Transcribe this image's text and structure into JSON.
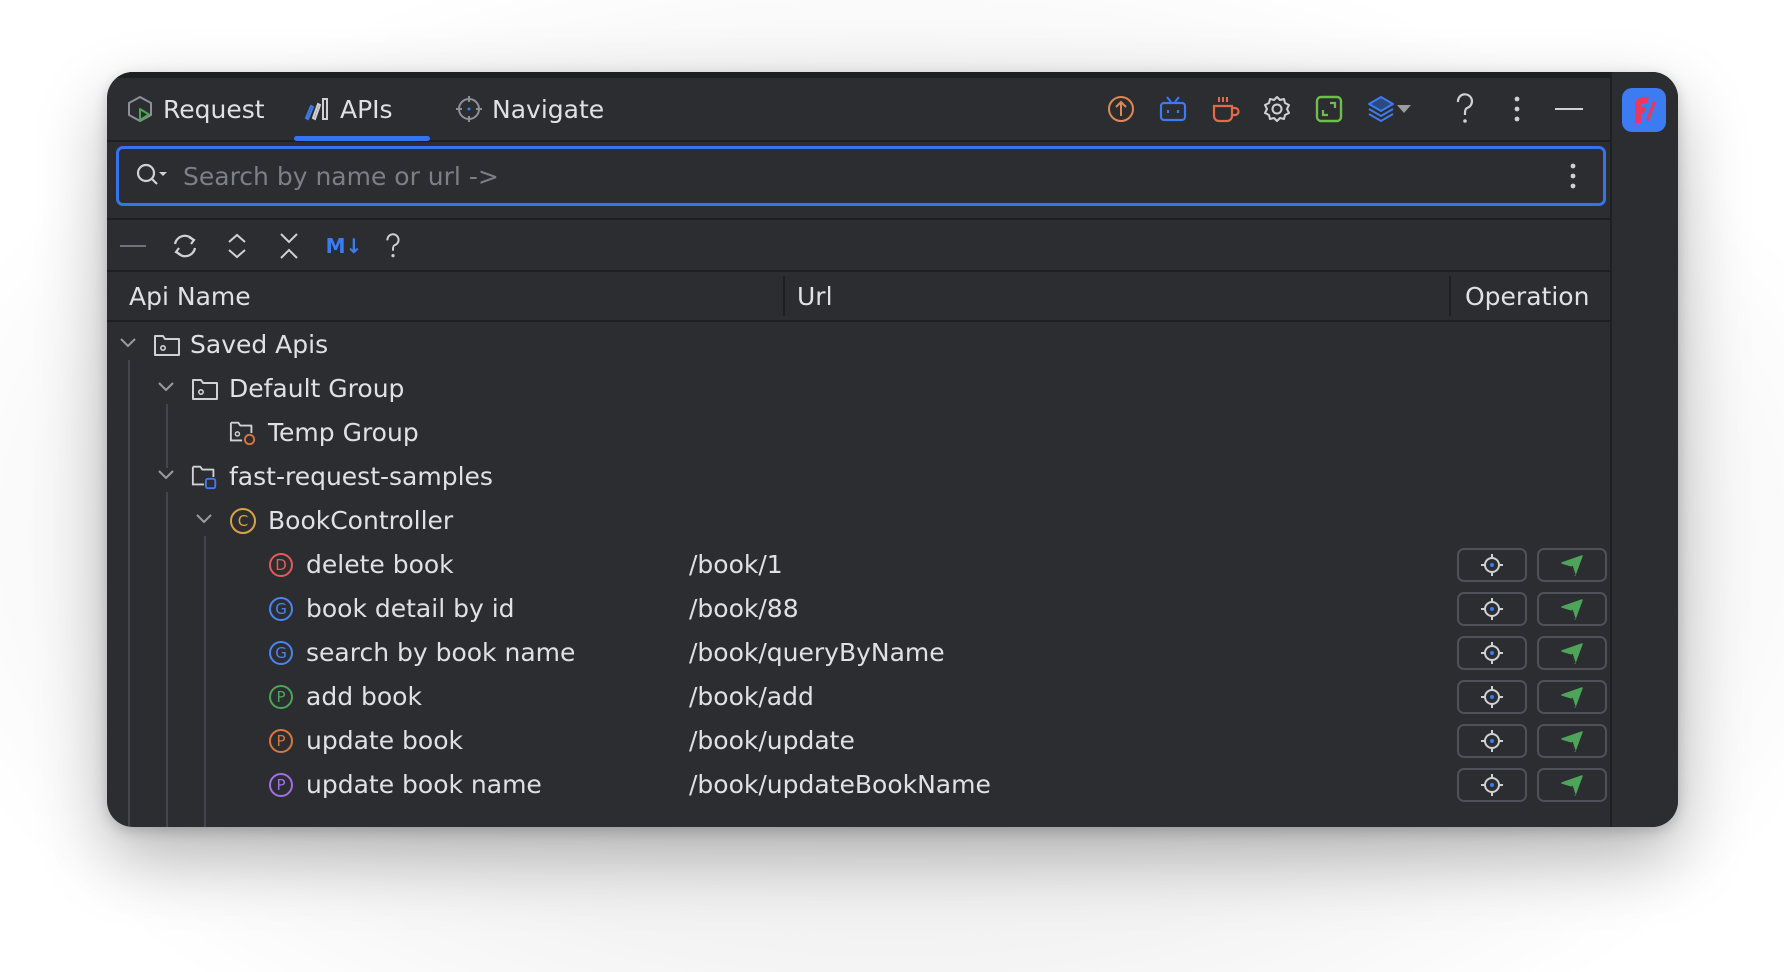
{
  "tabs": [
    {
      "label": "Request",
      "icon": "request-shield-play-icon",
      "active": false
    },
    {
      "label": "APIs",
      "icon": "apis-bars-icon",
      "active": true
    },
    {
      "label": "Navigate",
      "icon": "crosshair-icon",
      "active": false
    }
  ],
  "header_icons": [
    {
      "name": "upload-icon",
      "color": "#e08855"
    },
    {
      "name": "bilibili-tv-icon",
      "color": "#3d7bf2"
    },
    {
      "name": "coffee-cup-icon",
      "color": "#e8694a"
    },
    {
      "name": "gear-icon",
      "color": "#cfd1d5"
    },
    {
      "name": "expand-frame-icon",
      "color": "#6cc04a"
    },
    {
      "name": "layers-icon",
      "color": "#3d7bf2"
    },
    {
      "name": "dropdown-arrow-icon",
      "color": "#9a9ca0"
    },
    {
      "name": "help-icon",
      "color": "#cfd1d5"
    },
    {
      "name": "more-vertical-icon",
      "color": "#cfd1d5"
    },
    {
      "name": "minimize-icon",
      "color": "#cfd1d5"
    }
  ],
  "search": {
    "placeholder": "Search by name or url ->",
    "value": ""
  },
  "toolbar": {
    "items": [
      "collapse-line-icon",
      "refresh-icon",
      "expand-all-icon",
      "collapse-all-icon",
      "markdown-export-icon",
      "help-icon"
    ],
    "markdown_label": "M↓",
    "help_label": "?"
  },
  "columns": {
    "name": "Api Name",
    "url": "Url",
    "operation": "Operation"
  },
  "tree": {
    "saved_apis": "Saved Apis",
    "default_group": "Default Group",
    "temp_group": "Temp Group",
    "project": "fast-request-samples",
    "controller": "BookController",
    "controller_badge": "C",
    "apis": [
      {
        "method": "D",
        "color": "#e55b5b",
        "name": "delete book",
        "url": "/book/1"
      },
      {
        "method": "G",
        "color": "#4a86f0",
        "name": "book detail by id",
        "url": "/book/88"
      },
      {
        "method": "G",
        "color": "#4a86f0",
        "name": "search by book name",
        "url": "/book/queryByName"
      },
      {
        "method": "P",
        "color": "#4ea55a",
        "name": "add book",
        "url": "/book/add"
      },
      {
        "method": "P",
        "color": "#d9773f",
        "name": "update book",
        "url": "/book/update"
      },
      {
        "method": "P",
        "color": "#a56ee6",
        "name": "update book name",
        "url": "/book/updateBookName"
      }
    ]
  },
  "colors": {
    "accent": "#3574f0",
    "background": "#2b2d30",
    "send_green": "#4ea55a",
    "controller_gold": "#d9a343",
    "logo_bg": "#3d7bf2",
    "logo_fg": "#f0365a"
  }
}
